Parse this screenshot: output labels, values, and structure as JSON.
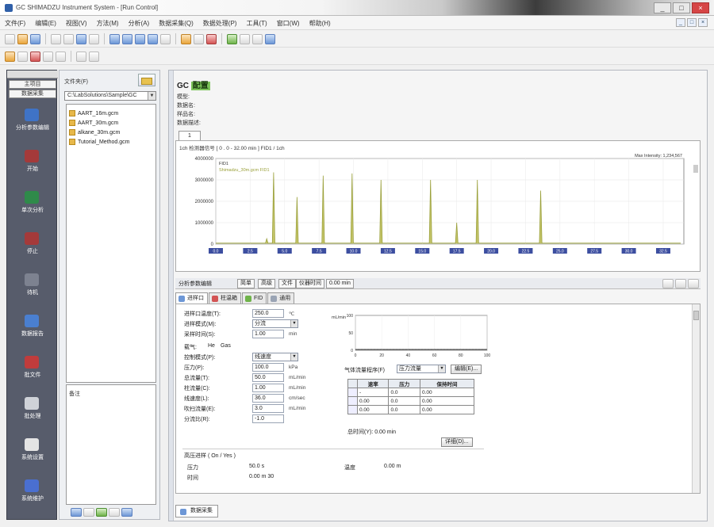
{
  "window": {
    "title": "GC SHIMADZU Instrument System - [Run Control]",
    "buttons": {
      "min": "_",
      "max": "□",
      "close": "×"
    }
  },
  "menu": {
    "items": [
      "文件(F)",
      "编辑(E)",
      "视图(V)",
      "方法(M)",
      "分析(A)",
      "数据采集(Q)",
      "数据处理(P)",
      "工具(T)",
      "窗口(W)",
      "帮助(H)"
    ],
    "mdi": [
      "_",
      "□",
      "×"
    ]
  },
  "nav": {
    "tab_label": "主项目",
    "sub_label": "数据采集",
    "items": [
      {
        "label": "分析参数编辑",
        "icon": "#3f73c6"
      },
      {
        "label": "开始",
        "icon": "#a43a3a"
      },
      {
        "label": "单次分析",
        "icon": "#2f8a4a"
      },
      {
        "label": "停止",
        "icon": "#a43a3a"
      },
      {
        "label": "待机",
        "icon": "#7d8290"
      },
      {
        "label": "数据报告",
        "icon": "#4a7fd0"
      },
      {
        "label": "批文件",
        "icon": "#c03c3c"
      },
      {
        "label": "批处理",
        "icon": "#cfd2d8"
      },
      {
        "label": "系统设置",
        "icon": "#e4e4e4"
      },
      {
        "label": "系统维护",
        "icon": "#4a6fd0"
      }
    ]
  },
  "file_panel": {
    "title": "文件夹(F)",
    "folder": "C:\\LabSolutions\\Sample\\GC",
    "files": [
      "AART_16m.gcm",
      "AART_30m.gcm",
      "alkane_30m.gcm",
      "Tutorial_Method.gcm"
    ],
    "notes_label": "备注"
  },
  "main": {
    "title_prefix": "GC",
    "title_highlight": "配置",
    "info_lines": [
      "模型:",
      "数据名:",
      "样品名:",
      "数据描述:"
    ],
    "chart_tab": "1",
    "chart_info": "1ch  检测器信号  [ 0 . 0 - 32.00 min ]  FID1  / 1ch"
  },
  "chart_data": {
    "type": "line",
    "title": "",
    "xlabel": "",
    "ylabel": "",
    "ylim": [
      0,
      4000000
    ],
    "xlim": [
      0,
      34
    ],
    "x_ticks": [
      "0.0",
      "2.5",
      "5.0",
      "7.5",
      "10.0",
      "12.5",
      "15.0",
      "17.5",
      "20.0",
      "22.5",
      "25.0",
      "27.5",
      "30.0",
      "32.5"
    ],
    "y_ticks": [
      "0",
      "1000000",
      "2000000",
      "3000000",
      "4000000"
    ],
    "legend": [
      "FID1",
      "Shimadzu_30m.gcm FID1"
    ],
    "legend_position": "top-left",
    "right_note": "Max Intensity: 1,234,567",
    "peaks": [
      {
        "x": 3.7,
        "y": 250000
      },
      {
        "x": 4.2,
        "y": 3350000
      },
      {
        "x": 5.9,
        "y": 2200000
      },
      {
        "x": 7.8,
        "y": 3200000
      },
      {
        "x": 9.9,
        "y": 3300000
      },
      {
        "x": 12.0,
        "y": 3000000
      },
      {
        "x": 15.6,
        "y": 3000000
      },
      {
        "x": 17.5,
        "y": 1000000
      },
      {
        "x": 19.0,
        "y": 3000000
      },
      {
        "x": 23.6,
        "y": 2500000
      }
    ],
    "grid": true
  },
  "method": {
    "title": "分析参数编辑",
    "buttons": [
      "简单",
      "高级",
      "文件",
      "仪器时间",
      "0.00 min"
    ],
    "tabs": [
      "进样口",
      "柱温箱",
      "FID",
      "通用"
    ],
    "params": [
      {
        "label": "进样口温度(T):",
        "value": "250.0",
        "unit": "℃"
      },
      {
        "label": "进样模式(M):",
        "value": "分流",
        "select": true
      },
      {
        "label": "采样时间(S):",
        "value": "1.00",
        "unit": "min"
      },
      {
        "label": "载气:",
        "value": "He",
        "unit": "Gas"
      },
      {
        "label": "控制模式(P):",
        "value": "线速度",
        "select": true
      },
      {
        "label": "压力(P):",
        "value": "100.0",
        "unit": "kPa"
      },
      {
        "label": "总流量(T):",
        "value": "50.0",
        "unit": "mL/min"
      },
      {
        "label": "柱流量(C):",
        "value": "1.00",
        "unit": "mL/min"
      },
      {
        "label": "线速度(L):",
        "value": "36.0",
        "unit": "cm/sec"
      },
      {
        "label": "吹扫流量(E):",
        "value": "3.0",
        "unit": "mL/min"
      },
      {
        "label": "分流比(R):",
        "value": "-1.0"
      }
    ],
    "mini_chart": {
      "y_label": "mL/min",
      "y_ticks": [
        "100",
        "50",
        "0"
      ],
      "x_ticks": [
        "0",
        "20",
        "40",
        "60",
        "80",
        "100"
      ]
    },
    "prog_label": "气体流量程序(F)",
    "prog_mode": "压力流量",
    "prog_button": "编辑(E)...",
    "table": {
      "headers": [
        "速率",
        "压力",
        "保持时间"
      ],
      "rows": [
        [
          "-",
          "0.0",
          "0.00"
        ],
        [
          "0.00",
          "0.0",
          "0.00"
        ],
        [
          "0.00",
          "0.0",
          "0.00"
        ]
      ]
    },
    "total_time": "总时间(Y): 0.00 min",
    "detail_button": "详细(D)...",
    "group_title": "高压进样 ( On / Yes )",
    "group_rows": [
      {
        "label": "压力",
        "value": "50.0 s",
        "label2": "温度",
        "value2": "0.00 m"
      },
      {
        "label": "时间",
        "value": "0.00 m 30"
      }
    ]
  },
  "bottom_tab": "数据采集"
}
